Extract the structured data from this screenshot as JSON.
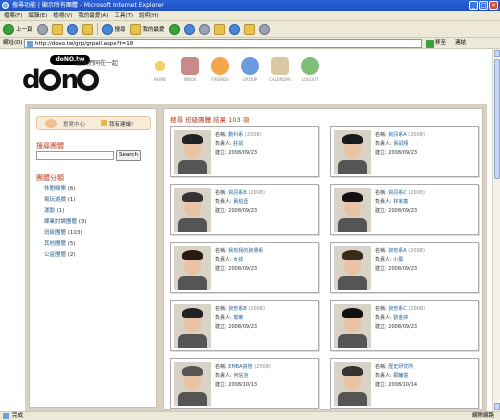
{
  "window": {
    "title": "搜尋功能 | 顯示所有團體 - Microsoft Internet Explorer"
  },
  "menu": [
    "檔案(F)",
    "編輯(E)",
    "檢視(V)",
    "我的最愛(A)",
    "工具(T)",
    "說明(H)"
  ],
  "toolbar": {
    "back": "上一頁",
    "search": "搜尋",
    "favorites": "我的最愛"
  },
  "address": {
    "label": "網址(D)",
    "url": "http://doso.tw/grp/grpall.aspx?t=18",
    "go": "移至",
    "links": "連結"
  },
  "site": {
    "logo_bubble": "doNO.tw",
    "logo_word_1": "d",
    "logo_word_2": "n",
    "slogan": "當我們同在一起",
    "nav": [
      {
        "label": "HOME",
        "icon": "home-icon"
      },
      {
        "label": "INBOX",
        "icon": "inbox-icon"
      },
      {
        "label": "FRIENDS",
        "icon": "friends-icon"
      },
      {
        "label": "GROUP",
        "icon": "group-icon"
      },
      {
        "label": "CALENDAR",
        "icon": "calendar-icon"
      },
      {
        "label": "LOGOUT",
        "icon": "logout-icon"
      }
    ]
  },
  "sidebar": {
    "message_center": "意見中心",
    "suggest": "我有建議!",
    "search_title": "搜尋團體",
    "search_button": "Search",
    "category_title": "團體分類",
    "categories": [
      {
        "name": "休閒娛樂",
        "count": "(6)"
      },
      {
        "name": "電玩遊戲",
        "count": "(1)"
      },
      {
        "name": "運動",
        "count": "(1)"
      },
      {
        "name": "課業討論團體",
        "count": "(3)"
      },
      {
        "name": "班級團體",
        "count": "(103)"
      },
      {
        "name": "其他團體",
        "count": "(5)"
      },
      {
        "name": "公益團體",
        "count": "(2)"
      }
    ]
  },
  "results": {
    "title": "搜尋 班級團體 結果 103 項",
    "label_name": "名稱:",
    "label_owner": "負責人:",
    "label_date": "建立:",
    "cards": [
      {
        "name": "動科系",
        "count": "(2008)",
        "owner": "莊凱",
        "date": "2008/09/23"
      },
      {
        "name": "資訊系A",
        "count": "(2008)",
        "owner": "黃凱翔",
        "date": "2008/09/23"
      },
      {
        "name": "資訊系B",
        "count": "(2008)",
        "owner": "黃柏壹",
        "date": "2008/09/23"
      },
      {
        "name": "資訊系C",
        "count": "(2008)",
        "owner": "林家鑫",
        "date": "2008/09/23"
      },
      {
        "name": "我有我的資傳系",
        "count": "",
        "owner": "女孩",
        "date": "2008/09/23"
      },
      {
        "name": "資管系A",
        "count": "(2008)",
        "owner": "小風",
        "date": "2008/09/23"
      },
      {
        "name": "資管系B",
        "count": "(2008)",
        "owner": "崙萊",
        "date": "2008/09/23"
      },
      {
        "name": "資管系C",
        "count": "(2008)",
        "owner": "劉金緯",
        "date": "2008/09/23"
      },
      {
        "name": "EMBA資管",
        "count": "(2008)",
        "owner": "何信池",
        "date": "2008/10/13"
      },
      {
        "name": "歷史研究所",
        "count": "",
        "owner": "鄭輔億",
        "date": "2008/10/14"
      }
    ]
  },
  "status": {
    "left": "完成",
    "right": "網際網路"
  }
}
